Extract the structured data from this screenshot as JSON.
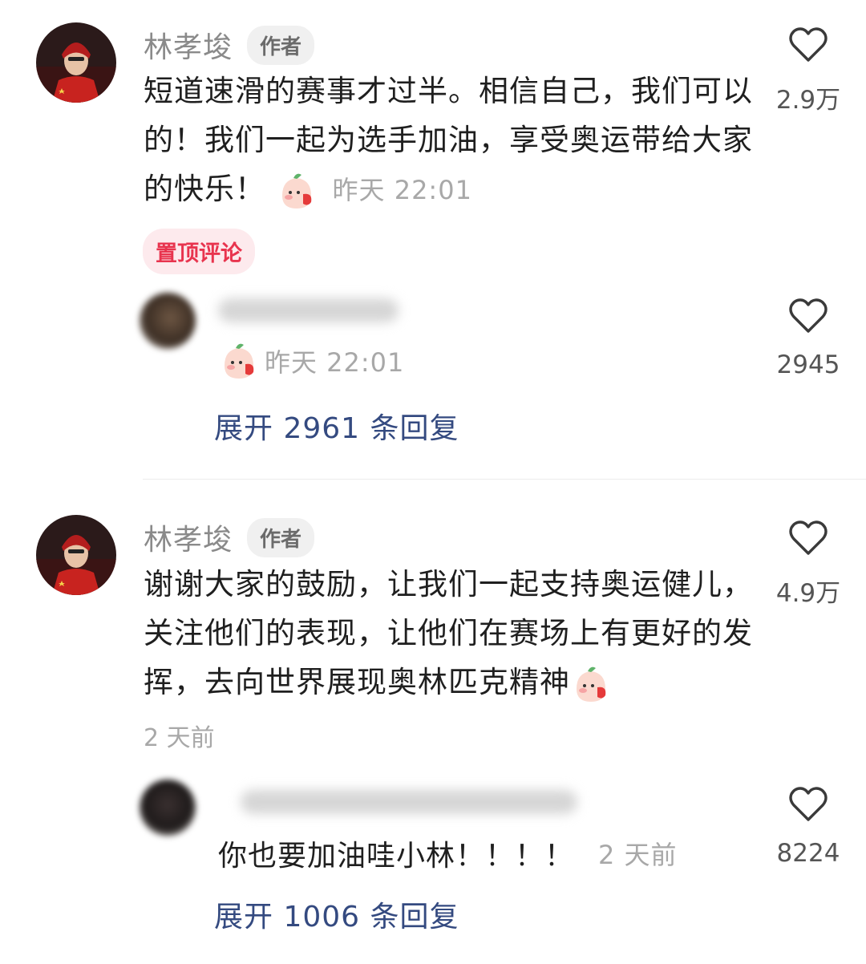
{
  "comments": [
    {
      "author": "林孝埈",
      "badge": "作者",
      "text": "短道速滑的赛事才过半。相信自己，我们可以的！我们一起为选手加油，享受奥运带给大家的快乐！",
      "time": "昨天 22:01",
      "pinned_label": "置顶评论",
      "likes": "2.9万",
      "reply": {
        "time": "昨天 22:01",
        "likes": "2945"
      },
      "expand_label": "展开 2961 条回复"
    },
    {
      "author": "林孝埈",
      "badge": "作者",
      "text": "谢谢大家的鼓励，让我们一起支持奥运健儿，关注他们的表现，让他们在赛场上有更好的发挥，去向世界展现奥林匹克精神",
      "time": "2 天前",
      "likes": "4.9万",
      "reply": {
        "text": "你也要加油哇小林！！！！",
        "time": "2 天前",
        "likes": "8224"
      },
      "expand_label": "展开 1006 条回复"
    }
  ],
  "icons": {
    "like": "heart-outline-icon",
    "emoji": "blushing-peach-emoji"
  },
  "colors": {
    "pinned_text": "#e8344e",
    "pinned_bg": "#fdeaed",
    "expand_link": "#344a80",
    "meta_gray": "#a8a8a8"
  }
}
